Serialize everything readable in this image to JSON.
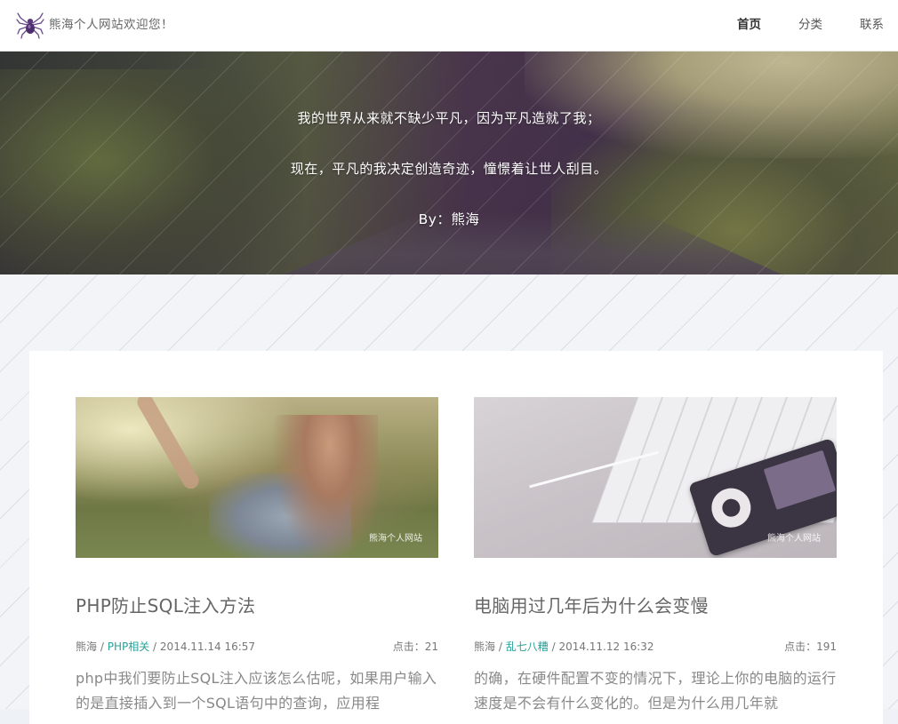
{
  "header": {
    "site_title": "熊海个人网站欢迎您！",
    "logo_icon": "spider-logo-icon",
    "nav": [
      {
        "label": "首页",
        "active": true
      },
      {
        "label": "分类",
        "active": false
      },
      {
        "label": "联系",
        "active": false
      }
    ]
  },
  "banner": {
    "line1": "我的世界从来就不缺少平凡，因为平凡造就了我；",
    "line2": "现在，平凡的我决定创造奇迹，憧憬着让世人刮目。",
    "line3": "By：熊海"
  },
  "posts": [
    {
      "watermark": "熊海个人网站",
      "title": "PHP防止SQL注入方法",
      "author": "熊海",
      "separator": "/",
      "category": "PHP相关",
      "date": "2014.11.14 16:57",
      "clicks": "点击：21",
      "excerpt": "php中我们要防止SQL注入应该怎么估呢，如果用户输入的是直接插入到一个SQL语句中的查询，应用程"
    },
    {
      "watermark": "熊海个人网站",
      "title": "电脑用过几年后为什么会变慢",
      "author": "熊海",
      "separator": "/",
      "category": "乱七八糟",
      "date": "2014.11.12 16:32",
      "clicks": "点击：191",
      "excerpt": "的确，在硬件配置不变的情况下，理论上你的电脑的运行速度是不会有什么变化的。但是为什么用几年就"
    }
  ],
  "colors": {
    "category_link": "#2aa198",
    "nav_active": "#333333"
  }
}
